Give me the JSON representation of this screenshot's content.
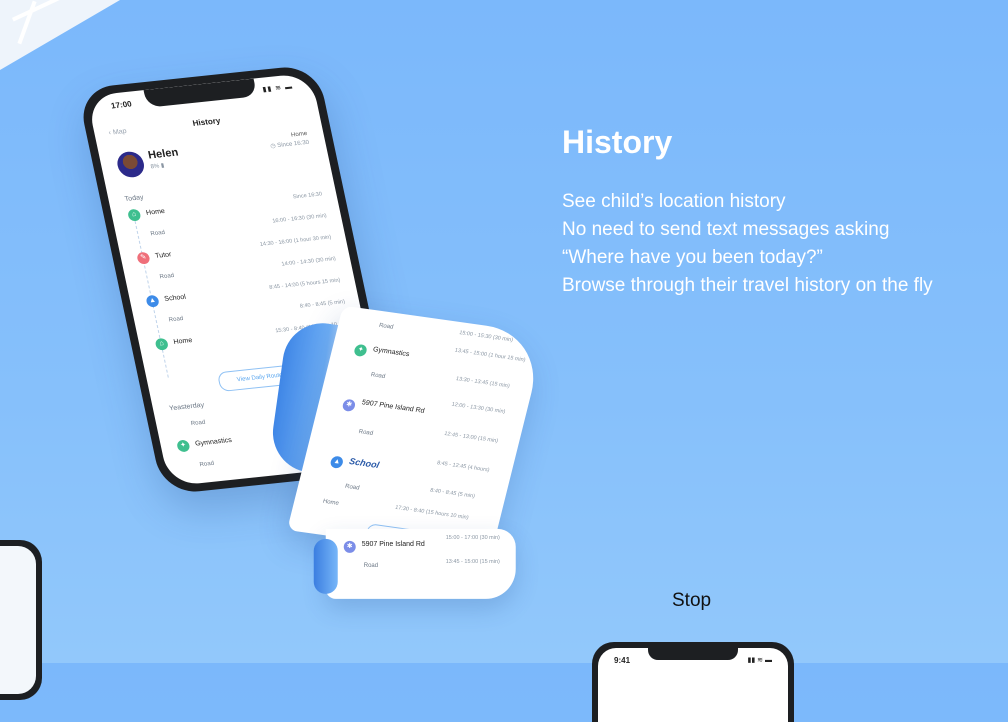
{
  "colors": {
    "background": "#7bb8fb",
    "accent": "#5aa6ef",
    "heading": "#ffffff"
  },
  "hero": {
    "title": "History",
    "lines": [
      "See child’s location history",
      "No need to send text messages asking",
      "“Where  have you been today?”",
      "Browse through their travel history on the fly"
    ]
  },
  "phone": {
    "time": "17:00",
    "status_icons": "▮▮ ≋ ▬",
    "back": "‹ Map",
    "title": "History",
    "child": {
      "name": "Helen",
      "sub": "8% ▮",
      "place": "Home",
      "since": "◷ Since 16:30"
    },
    "today_label": "Today",
    "yesterday_label": "Yeasterday",
    "entries": [
      {
        "label": "Home",
        "time": "Since 16:30",
        "icon": "home-icon",
        "color": "#3fbf8f"
      },
      {
        "label": "Road",
        "time": "16:00 - 16:30 (30 min)",
        "icon": "road",
        "color": ""
      },
      {
        "label": "Tutor",
        "time": "14:30 - 16:00 (1 hour 30 min)",
        "icon": "tutor-icon",
        "color": "#ef6f7a"
      },
      {
        "label": "Road",
        "time": "14:00 - 14:30 (30 min)",
        "icon": "road",
        "color": ""
      },
      {
        "label": "School",
        "time": "8:45 - 14:00 (5 hours 15 min)",
        "icon": "school-icon",
        "color": "#3d8be8"
      },
      {
        "label": "Road",
        "time": "8:40 - 8:45 (5 min)",
        "icon": "road",
        "color": ""
      },
      {
        "label": "Home",
        "time": "15:30 - 8:40 (16 hours 10 min)",
        "icon": "home-icon",
        "color": "#3fbf8f"
      }
    ],
    "view_button": "View Daily Route",
    "yesterday_entries": [
      {
        "label": "Road",
        "icon": "road",
        "color": ""
      },
      {
        "label": "Gymnastics",
        "icon": "gym-icon",
        "color": "#3fbf8f"
      },
      {
        "label": "Road",
        "icon": "road",
        "color": ""
      }
    ]
  },
  "paper": {
    "rows": [
      {
        "label": "Road",
        "time": "15:00 - 15:30 (30 min)"
      },
      {
        "label": "Gymnastics",
        "time": "13:45 - 15:00 (1 hour 15 min)"
      },
      {
        "label": "Road",
        "time": "13:30 - 13:45 (15 min)"
      },
      {
        "label": "5907 Pine Island Rd",
        "time": "12:00 - 13:30 (30 min)"
      },
      {
        "label": "Road",
        "time": "12:45 - 13:00 (15 min)"
      },
      {
        "label": "School",
        "time": "8:45 - 12:45 (4 hours)"
      },
      {
        "label": "Road",
        "time": "8:40 - 8:45 (5 min)"
      },
      {
        "label": "Home",
        "time": "17:30 - 8:40 (15 hours 10 min)"
      },
      {
        "label": "5907 Pine Island Rd",
        "time": "15:00 - 17:00 (30 min)"
      },
      {
        "label": "Road",
        "time": "13:45 - 15:00 (15 min)"
      }
    ],
    "button": "View Daily Route"
  },
  "stop": {
    "label": "Stop"
  },
  "bottom_phone": {
    "time": "9:41",
    "status_icons": "▮▮ ≋ ▬"
  }
}
